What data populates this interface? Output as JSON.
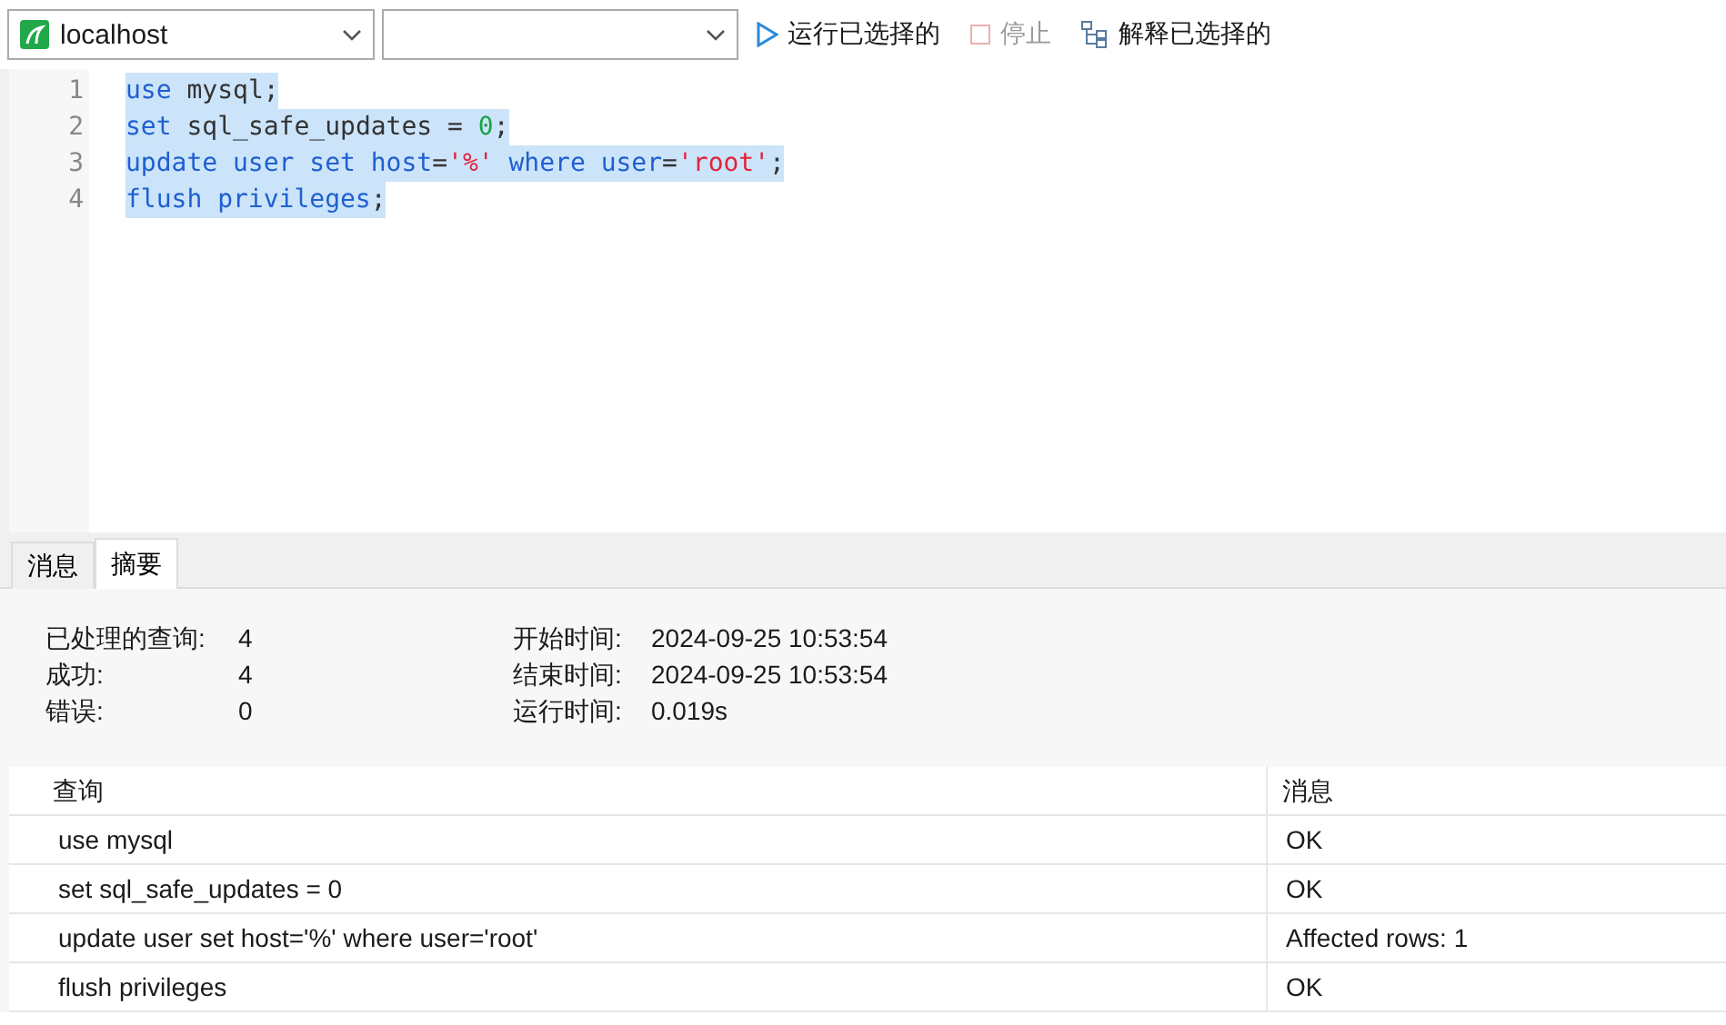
{
  "toolbar": {
    "connection": {
      "value": "localhost"
    },
    "buttons": [
      {
        "kind": "run",
        "label": "运行已选择的",
        "disabled": false
      },
      {
        "kind": "stop",
        "label": "停止",
        "disabled": true
      },
      {
        "kind": "explain",
        "label": "解释已选择的",
        "disabled": false
      }
    ]
  },
  "editor": {
    "lines": [
      {
        "number": "1",
        "selected": true,
        "tokens": [
          {
            "kind": "keyword",
            "text": "use"
          },
          {
            "kind": "plain",
            "text": " mysql;"
          }
        ]
      },
      {
        "number": "2",
        "selected": true,
        "tokens": [
          {
            "kind": "keyword",
            "text": "set"
          },
          {
            "kind": "plain",
            "text": " sql_safe_updates = "
          },
          {
            "kind": "number",
            "text": "0"
          },
          {
            "kind": "plain",
            "text": ";"
          }
        ]
      },
      {
        "number": "3",
        "selected": true,
        "tokens": [
          {
            "kind": "keyword",
            "text": "update user set host"
          },
          {
            "kind": "plain",
            "text": "="
          },
          {
            "kind": "string",
            "text": "'%'"
          },
          {
            "kind": "keyword",
            "text": " where user"
          },
          {
            "kind": "plain",
            "text": "="
          },
          {
            "kind": "string",
            "text": "'root'"
          },
          {
            "kind": "plain",
            "text": ";"
          }
        ]
      },
      {
        "number": "4",
        "selected": true,
        "tokens": [
          {
            "kind": "keyword",
            "text": "flush privileges"
          },
          {
            "kind": "plain",
            "text": ";"
          }
        ]
      }
    ]
  },
  "tabs": [
    {
      "label": "消息",
      "selected": false
    },
    {
      "label": "摘要",
      "selected": true
    }
  ],
  "summary": {
    "left": [
      {
        "label": "已处理的查询:",
        "value": "4"
      },
      {
        "label": "成功:",
        "value": "4"
      },
      {
        "label": "错误:",
        "value": "0"
      }
    ],
    "right": [
      {
        "label": "开始时间:",
        "value": "2024-09-25 10:53:54"
      },
      {
        "label": "结束时间:",
        "value": "2024-09-25 10:53:54"
      },
      {
        "label": "运行时间:",
        "value": "0.019s"
      }
    ]
  },
  "table": {
    "columns": [
      "查询",
      "消息"
    ],
    "rows": [
      [
        "use mysql",
        "OK"
      ],
      [
        "set sql_safe_updates = 0",
        "OK"
      ],
      [
        "update user set host='%' where user='root'",
        "Affected rows: 1"
      ],
      [
        "flush privileges",
        "OK"
      ]
    ]
  }
}
